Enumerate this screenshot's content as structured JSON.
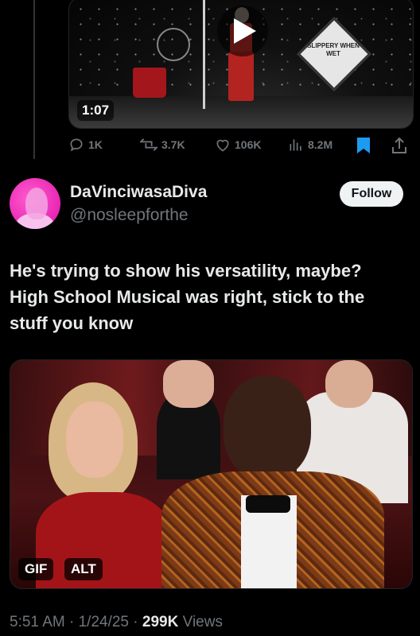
{
  "quoted_video": {
    "duration": "1:07",
    "sign_text": "SLIPPERY WHEN WET",
    "icons": [
      "play-icon"
    ]
  },
  "action_bar": {
    "replies": "1K",
    "reposts": "3.7K",
    "likes": "106K",
    "views": "8.2M",
    "icons": [
      "reply-icon",
      "repost-icon",
      "like-icon",
      "views-icon",
      "bookmark-icon",
      "share-icon"
    ],
    "bookmark_color": "#1d9bf0"
  },
  "tweet": {
    "display_name": "DaVinciwasaDiva",
    "handle": "@nosleepforthe",
    "follow_label": "Follow",
    "text_lines": [
      "He's trying to show his versatility, maybe?",
      "High School Musical was right, stick to the",
      "stuff you know"
    ],
    "media": {
      "gif_label": "GIF",
      "alt_label": "ALT"
    },
    "meta": {
      "time": "5:51 AM",
      "separator": "·",
      "date": "1/24/25",
      "views_count": "299K",
      "views_label": "Views"
    }
  },
  "colors": {
    "background": "#000000",
    "text_primary": "#e7e9ea",
    "text_secondary": "#71767b",
    "avatar_bg": "#e011a9"
  }
}
